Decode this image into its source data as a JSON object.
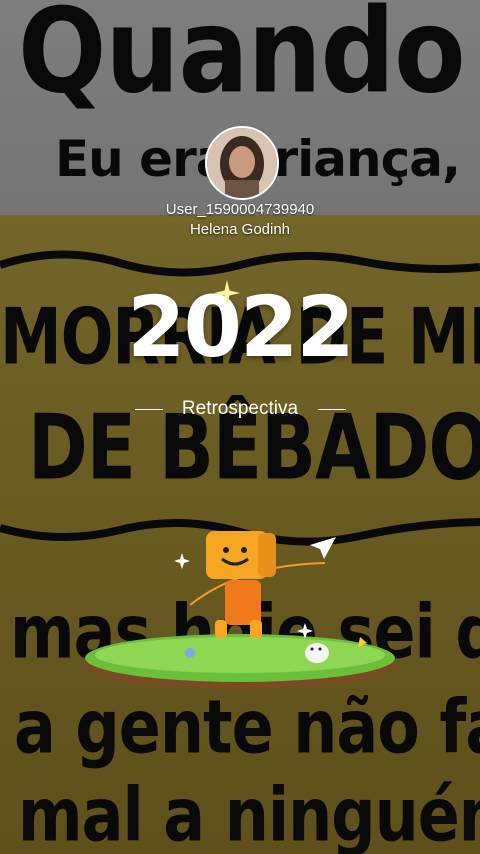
{
  "background": {
    "line1": "Quando",
    "line2": "Eu era criança,",
    "line3": "MORRIA DE MEDO",
    "line4": "DE BÊBADO...",
    "line5": "mas hoje sei que",
    "line6": "a gente não faz",
    "line7": "mal a ninguém !!!"
  },
  "profile": {
    "username": "User_1590004739940",
    "display_name": "Helena Godinh"
  },
  "recap": {
    "year": "2022",
    "label": "Retrospectiva"
  },
  "colors": {
    "accent_yellow": "#f5c518",
    "text": "#ffffff"
  }
}
